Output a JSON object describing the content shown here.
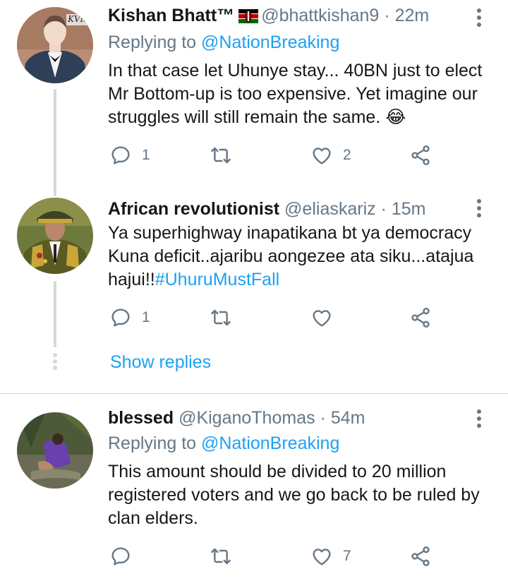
{
  "tweets": [
    {
      "name": "Kishan Bhatt™",
      "flag": "kenya-flag",
      "handle": "@bhattkishan9",
      "dot": "·",
      "time": "22m",
      "replying_prefix": "Replying to ",
      "replying_to": "@NationBreaking",
      "text_lines": [
        "In that case let Uhunye stay... 40BN just to elect",
        "Mr Bottom-up is too expensive. Yet imagine our",
        "struggles will still remain the same. 😂"
      ],
      "avatar_text": "KVIS",
      "reply_count": "1",
      "retweet_count": "",
      "like_count": "2"
    },
    {
      "name": "African revolutionist",
      "handle": "@eliaskariz",
      "dot": "·",
      "time": "15m",
      "text_lines": [
        "Ya superhighway inapatikana bt ya democracy",
        "Kuna deficit..ajaribu aongezee ata siku...atajua"
      ],
      "text_last_prefix": "hajui!!",
      "hashtag": "#UhuruMustFall",
      "reply_count": "1",
      "retweet_count": "",
      "like_count": ""
    },
    {
      "name": "blessed",
      "handle": "@KiganoThomas",
      "dot": "·",
      "time": "54m",
      "replying_prefix": "Replying to ",
      "replying_to": "@NationBreaking",
      "text_lines": [
        "This amount should be divided to 20 million",
        "registered voters and we go back to be ruled by",
        "clan elders."
      ],
      "reply_count": "",
      "retweet_count": "",
      "like_count": "7"
    }
  ],
  "show_replies": "Show replies",
  "colors": {
    "accent": "#1da1f2",
    "muted": "#657786",
    "text": "#14171a",
    "thread_line": "#cfd9de"
  },
  "icons": [
    "reply-icon",
    "retweet-icon",
    "like-icon",
    "share-icon",
    "more-icon"
  ]
}
